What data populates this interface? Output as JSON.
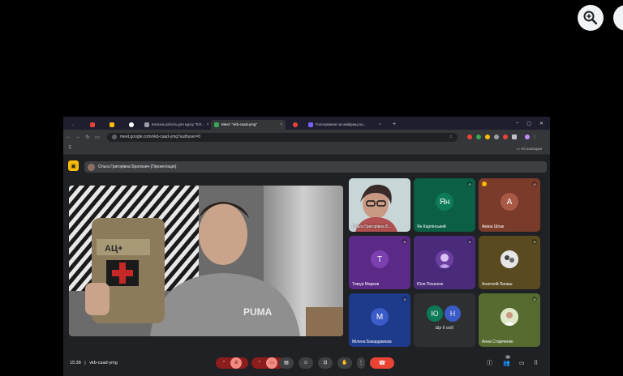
{
  "viewer": {
    "zoom_icon": "zoom-in-icon"
  },
  "browser": {
    "tabs": [
      {
        "label": "",
        "color": "#ea4335"
      },
      {
        "label": "",
        "color": "#fbbc04"
      },
      {
        "label": "",
        "color": "#ffffff"
      },
      {
        "label": "Класна робота для курсу \"ЕЛ...",
        "color": "#9aa0a6"
      },
      {
        "label": "Meet: \"vkb-caad-ymg\"",
        "color": "#34a853"
      },
      {
        "label": "",
        "color": "#ea4335"
      },
      {
        "label": "Голосування за найкращі ко...",
        "color": "#7b61ff"
      }
    ],
    "url": "meet.google.com/vkb-caad-ymg?authuser=0",
    "bookmarks_label": "Усі закладки"
  },
  "meet": {
    "presenter_label": "Ольга Григорівна Братанич (Презентація)",
    "participants": [
      {
        "name": "Ольга Григорівна Б...",
        "initials": "",
        "bg": "#c9d6d8",
        "avatar_bg": ""
      },
      {
        "name": "Ян Карпінський",
        "initials": "Ян",
        "bg": "#0b5f45",
        "avatar_bg": "#0d7a58"
      },
      {
        "name": "Аміна Шпак",
        "initials": "А",
        "bg": "#7a3b2a",
        "avatar_bg": "#a85a44"
      },
      {
        "name": "Тимур Марков",
        "initials": "Т",
        "bg": "#5b2a86",
        "avatar_bg": "#7b3fb0"
      },
      {
        "name": "Юля Покалюк",
        "initials": "",
        "bg": "#4a2a7a",
        "avatar_bg": "#7b3fb0"
      },
      {
        "name": "Анатолій Лапиш",
        "initials": "",
        "bg": "#5a4a1f",
        "avatar_bg": "#ddd"
      },
      {
        "name": "Мілена Бакарджиєва",
        "initials": "М",
        "bg": "#1e3a8a",
        "avatar_bg": "#3b5bc8"
      },
      {
        "name": "Ще 6 осіб",
        "initials": "",
        "bg": "#2d2f31",
        "avatar_bg": ""
      },
      {
        "name": "Анна Старіченко",
        "initials": "",
        "bg": "#556b2f",
        "avatar_bg": "#e8f0d0"
      }
    ],
    "more_avatars": [
      "Ю",
      "Н"
    ],
    "time": "15:38",
    "meeting_code": "vkb-caad-ymg",
    "badge_count": "15"
  }
}
